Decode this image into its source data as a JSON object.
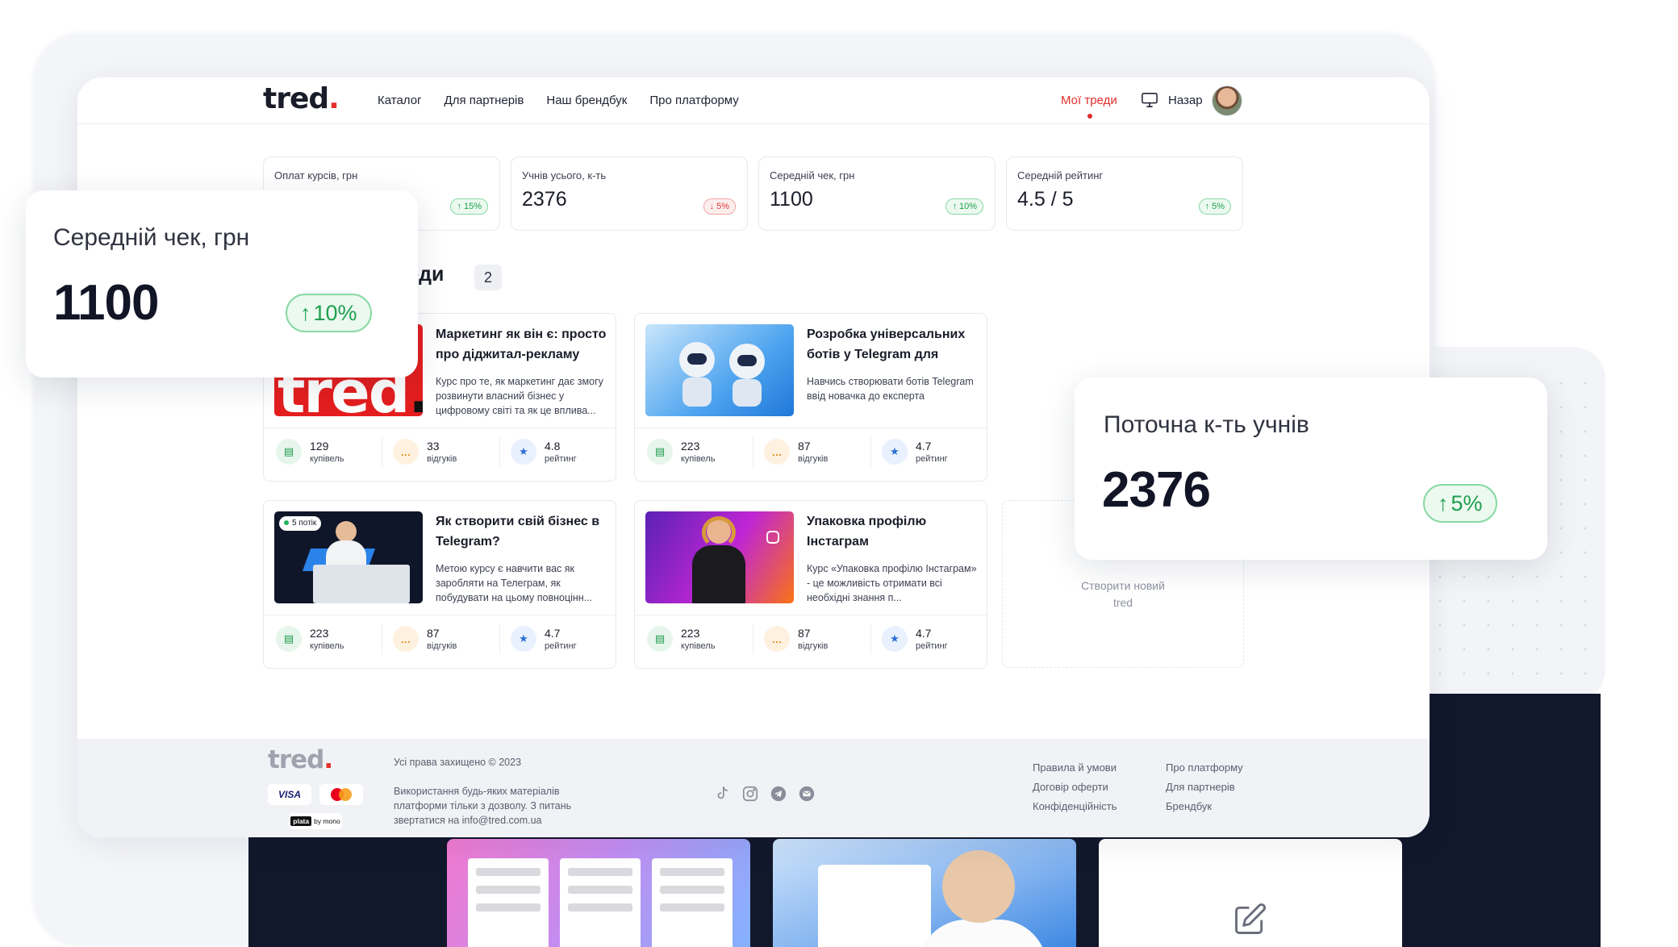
{
  "nav": {
    "logo": "tred",
    "links": [
      "Каталог",
      "Для партнерів",
      "Наш брендбук",
      "Про платформу"
    ],
    "my_treds": "Мої треди",
    "user_name": "Назар"
  },
  "stats": [
    {
      "label": "Оплат курсів, грн",
      "value": "",
      "change": "15%",
      "direction": "up"
    },
    {
      "label": "Учнів усього, к-ть",
      "value": "2376",
      "change": "5%",
      "direction": "down"
    },
    {
      "label": "Середній чек, грн",
      "value": "1100",
      "change": "10%",
      "direction": "up"
    },
    {
      "label": "Середній рейтинг",
      "value": "4.5 / 5",
      "change": "5%",
      "direction": "up"
    }
  ],
  "section": {
    "title": "реди",
    "count": "2"
  },
  "courses": [
    {
      "title": "Маркетинг як він є: просто про діджитал-рекламу",
      "description": "Курс про те, як маркетинг дає змогу розвинути власний бізнес у цифровому світі та як це вплива...",
      "purchases": "129",
      "reviews": "33",
      "rating": "4.8"
    },
    {
      "title": "Розробка універсальних ботів у Telegram для рекл...",
      "description": "Навчись створювати ботів Telegram ввід новачка до експерта",
      "purchases": "223",
      "reviews": "87",
      "rating": "4.7"
    },
    {
      "title": "Як створити свій бізнес в Telegram?",
      "description": "Метою курсу є навчити вас як заробляти на Телеграм, як побудувати на цьому повноцінн...",
      "purchases": "223",
      "reviews": "87",
      "rating": "4.7",
      "badge": "5 потік"
    },
    {
      "title": "Упаковка профілю Інстаграм",
      "description": "Курс «Упаковка профілю Інстаграм» - це можливість отримати всі необхідні знання п...",
      "purchases": "223",
      "reviews": "87",
      "rating": "4.7"
    }
  ],
  "units": {
    "purchases": "купівель",
    "reviews": "відгуків",
    "rating": "рейтинг"
  },
  "create": {
    "label_line1": "Створити новий",
    "label_line2": "tred"
  },
  "footer": {
    "logo": "tred",
    "copyright": "Усі права захищено © 2023",
    "policy": "Використання будь-яких матеріалів платформи тільки з дозволу. З питань звертатися на info@tred.com.ua",
    "pay_visa": "VISA",
    "pay_plata": "plata",
    "pay_plata_suffix": "by mono",
    "links_col1": [
      "Правила й умови",
      "Договір оферти",
      "Конфіденційність"
    ],
    "links_col2": [
      "Про платформу",
      "Для партнерів",
      "Брендбук"
    ]
  },
  "float_avg_check": {
    "label": "Середній чек, грн",
    "value": "1100",
    "change": "10%"
  },
  "float_students": {
    "label": "Поточна к-ть учнів",
    "value": "2376",
    "change": "5%"
  },
  "colors": {
    "accent": "#e12d2a",
    "up": "#1f9f4f",
    "down": "#dc3a3a",
    "dark": "#12182b"
  }
}
